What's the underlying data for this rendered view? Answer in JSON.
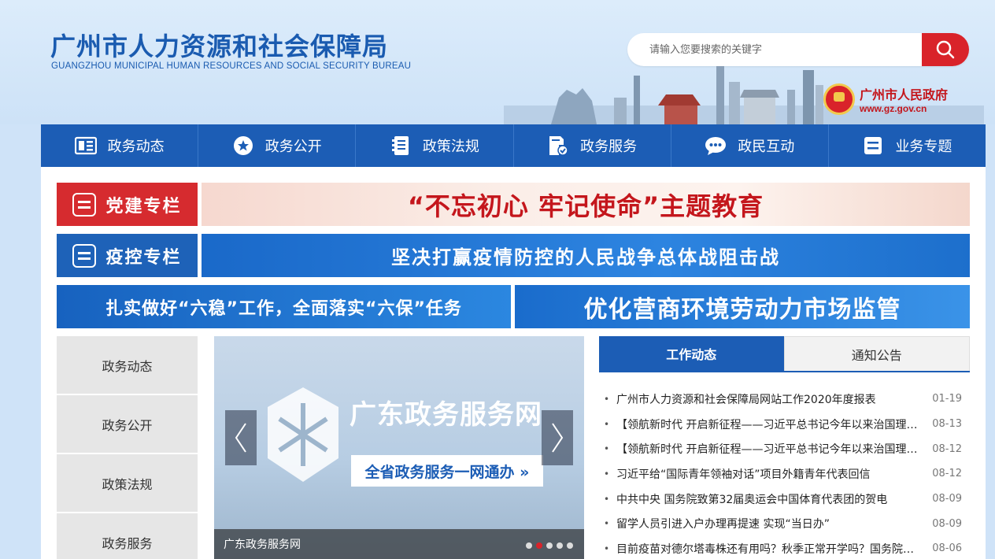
{
  "header": {
    "title_cn": "广州市人力资源和社会保障局",
    "title_en": "GUANGZHOU MUNICIPAL HUMAN RESOURCES AND SOCIAL SECURITY BUREAU",
    "search_placeholder": "请输入您要搜索的关键字",
    "gov_name": "广州市人民政府",
    "gov_url": "www.gz.gov.cn"
  },
  "nav": {
    "items": [
      {
        "label": "政务动态",
        "icon": "news-icon"
      },
      {
        "label": "政务公开",
        "icon": "star-icon"
      },
      {
        "label": "政策法规",
        "icon": "document-icon"
      },
      {
        "label": "政务服务",
        "icon": "service-icon"
      },
      {
        "label": "政民互动",
        "icon": "chat-icon"
      },
      {
        "label": "业务专题",
        "icon": "list-icon"
      }
    ]
  },
  "columns": {
    "party_label": "党建专栏",
    "party_banner": "“不忘初心 牢记使命”主题教育",
    "epidemic_label": "疫控专栏",
    "epidemic_banner": "坚决打赢疫情防控的人民战争总体战阻击战",
    "banner_left": "扎实做好“六稳”工作，全面落实“六保”任务",
    "banner_right": "优化营商环境劳动力市场监管"
  },
  "sidebar": {
    "items": [
      {
        "label": "政务动态"
      },
      {
        "label": "政务公开"
      },
      {
        "label": "政策法规"
      },
      {
        "label": "政务服务"
      }
    ]
  },
  "carousel": {
    "title": "广东政务服务网",
    "subtitle": "全省政务服务一网通办 »",
    "caption": "广东政务服务网",
    "dots": 5,
    "active_dot": 1
  },
  "news": {
    "tabs": [
      {
        "label": "工作动态",
        "active": true
      },
      {
        "label": "通知公告",
        "active": false
      }
    ],
    "items": [
      {
        "title": "广州市人力资源和社会保障局网站工作2020年度报表",
        "date": "01-19"
      },
      {
        "title": "【领航新时代 开启新征程——习近平总书记今年以来治国理政纪实】",
        "date": "08-13"
      },
      {
        "title": "【领航新时代 开启新征程——习近平总书记今年以来治国理政纪实】",
        "date": "08-12"
      },
      {
        "title": "习近平给“国际青年领袖对话”项目外籍青年代表回信",
        "date": "08-12"
      },
      {
        "title": "中共中央 国务院致第32届奥运会中国体育代表团的贺电",
        "date": "08-09"
      },
      {
        "title": "留学人员引进入户办理再提速 实现“当日办”",
        "date": "08-09"
      },
      {
        "title": "目前疫苗对德尔塔毒株还有用吗？秋季正常开学吗？国务院联防联控机制",
        "date": "08-06"
      }
    ]
  },
  "colors": {
    "primary_blue": "#1c5db5",
    "party_red": "#d62b2f",
    "search_red": "#d9232a"
  }
}
